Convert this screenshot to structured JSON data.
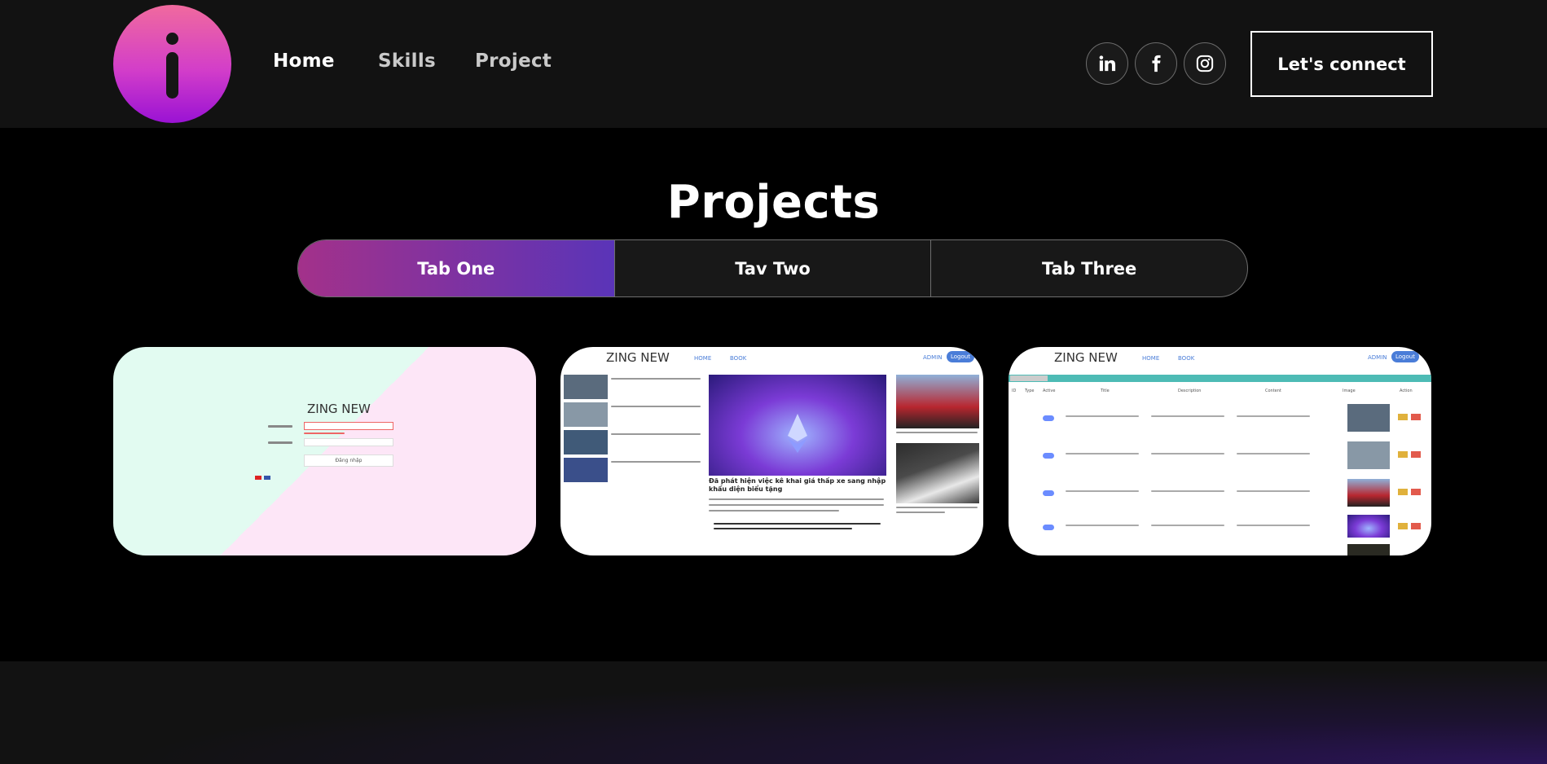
{
  "nav": {
    "links": [
      "Home",
      "Skills",
      "Project"
    ],
    "socials": [
      "linkedin-icon",
      "facebook-icon",
      "instagram-icon"
    ],
    "connect_label": "Let's connect"
  },
  "projects": {
    "title": "Projects",
    "tabs": [
      "Tab One",
      "Tav Two",
      "Tab Three"
    ],
    "active_tab": 0
  },
  "cards": [
    {
      "brand": "ZING NEW",
      "login_button": "Đăng nhập"
    },
    {
      "brand": "ZING NEW",
      "nav": [
        "HOME",
        "BOOK"
      ],
      "admin": "ADMIN",
      "logout": "Logout",
      "headline": "Đã phát hiện việc kê khai giá thấp xe sang nhập khẩu diện biểu tặng"
    },
    {
      "brand": "ZING NEW",
      "nav": [
        "HOME",
        "BOOK"
      ],
      "admin": "ADMIN",
      "logout": "Logout",
      "columns": [
        "ID",
        "Type",
        "Active",
        "Title",
        "Description",
        "Content",
        "Image",
        "Action"
      ]
    }
  ],
  "colors": {
    "accent_start": "#a3318a",
    "accent_end": "#5a34b8",
    "logo_start": "#f06a9e",
    "logo_end": "#9a12d4"
  }
}
